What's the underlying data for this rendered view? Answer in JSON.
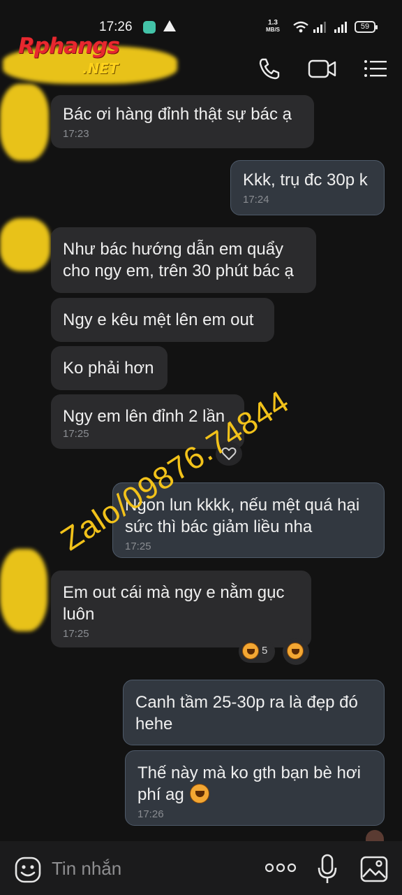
{
  "status_bar": {
    "time": "17:26",
    "net_speed_value": "1.3",
    "net_speed_unit": "MB/S",
    "battery": "59"
  },
  "header": {
    "logo_main": "Rphangs",
    "logo_sub": ".NET",
    "icons": [
      "phone-icon",
      "video-call-icon",
      "menu-icon"
    ]
  },
  "messages": [
    {
      "side": "in",
      "text": "Bác ơi hàng đỉnh thật sự bác ạ",
      "time": "17:23"
    },
    {
      "side": "out",
      "text": "Kkk, trụ đc 30p k",
      "time": "17:24"
    },
    {
      "side": "in",
      "text": "Như bác hướng dẫn em quẩy cho ngy em, trên 30 phút bác ạ",
      "time": ""
    },
    {
      "side": "in",
      "text": "Ngy e kêu mệt lên em out",
      "time": ""
    },
    {
      "side": "in",
      "text": "Ko phải hơn",
      "time": ""
    },
    {
      "side": "in",
      "text": "Ngy em lên đỉnh 2 lần",
      "time": "17:25"
    },
    {
      "side": "out",
      "text": "Ngon lun kkkk, nếu mệt quá hại sức thì bác giảm liều nha",
      "time": "17:25"
    },
    {
      "side": "in",
      "text": "Em out cái mà ngy e nằm gục luôn",
      "time": "17:25"
    },
    {
      "side": "out",
      "text": "Canh tầm 25-30p ra là đẹp đó hehe",
      "time": ""
    },
    {
      "side": "out",
      "text": "Thế này mà ko gth bạn bè hơi phí ag",
      "time": "17:26"
    }
  ],
  "reactions": {
    "heart_icon": "heart-icon",
    "laugh_count": "5"
  },
  "watermark": "Zalo/09876.74844",
  "composer": {
    "placeholder": "Tin nhắn"
  },
  "colors": {
    "background": "#121212",
    "incoming_bubble": "#2b2b2d",
    "outgoing_bubble": "#323840",
    "watermark": "#f2c21a"
  }
}
